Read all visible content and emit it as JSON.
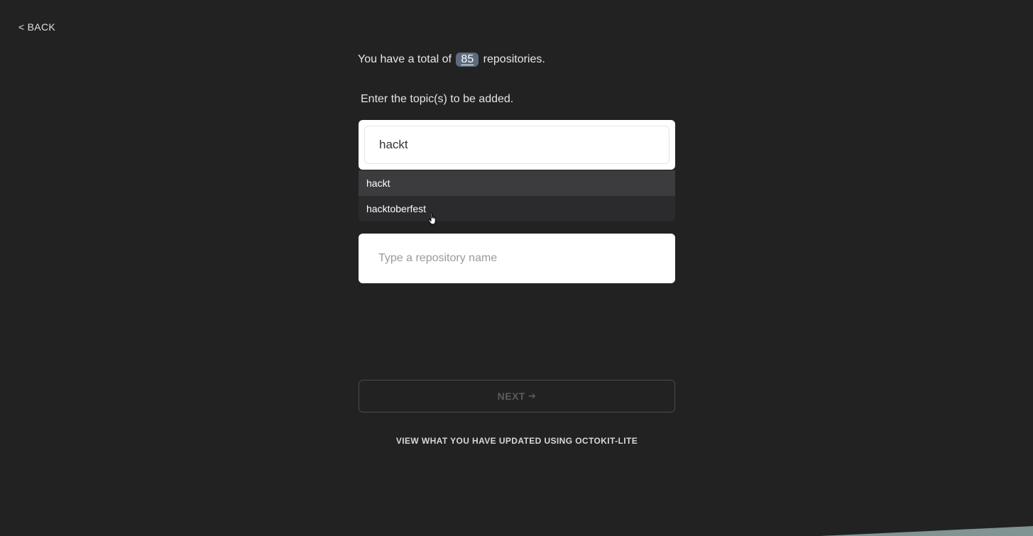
{
  "nav": {
    "back_label": "< BACK"
  },
  "summary": {
    "prefix": "You have a total of",
    "repo_count": "85",
    "suffix": "repositories."
  },
  "topic": {
    "label": "Enter the topic(s) to be added.",
    "input_value": "hackt",
    "suggestions": [
      {
        "label": "hackt"
      },
      {
        "label": "hacktoberfest"
      }
    ]
  },
  "repo": {
    "placeholder": "Type a repository name",
    "input_value": ""
  },
  "next": {
    "label": "NEXT",
    "arrow_icon": "arrow-right-icon"
  },
  "footer": {
    "view_link": "VIEW WHAT YOU HAVE UPDATED USING OCTOKIT-LITE"
  },
  "colors": {
    "background": "#222222",
    "count_badge": "#5d6b7f",
    "dropdown_bg": "#2b2b2d",
    "dropdown_active": "#3c3c3f",
    "corner_accent": "#7f9493"
  }
}
